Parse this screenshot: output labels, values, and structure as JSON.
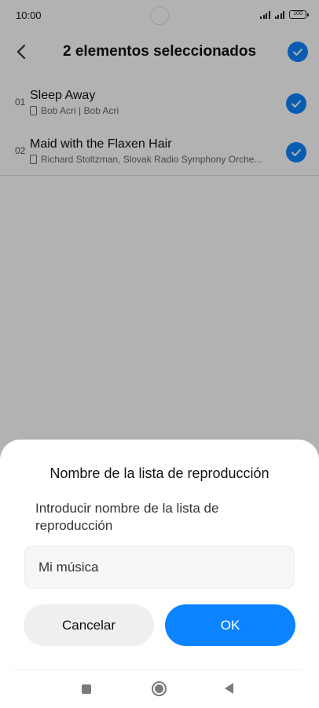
{
  "status_bar": {
    "time": "10:00",
    "battery": "100"
  },
  "header": {
    "title": "2 elementos seleccionados",
    "back_icon": "chevron-left-icon",
    "select_all_icon": "check-circle-icon"
  },
  "songs": [
    {
      "number": "01",
      "title": "Sleep Away",
      "subtitle": "Bob Acri | Bob Acri",
      "selected": true
    },
    {
      "number": "02",
      "title": "Maid with the Flaxen Hair",
      "subtitle": "Richard Stoltzman, Slovak Radio Symphony Orche...",
      "selected": true
    }
  ],
  "dialog": {
    "title": "Nombre de la lista de reproducción",
    "message": "Introducir nombre de la lista de reproducción",
    "input_value": "Mi música",
    "cancel_label": "Cancelar",
    "ok_label": "OK"
  },
  "colors": {
    "accent": "#0d84ff",
    "cancel_bg": "#efefef"
  },
  "nav_bar": {
    "recent_icon": "square-icon",
    "home_icon": "circle-icon",
    "back_icon": "triangle-back-icon"
  }
}
